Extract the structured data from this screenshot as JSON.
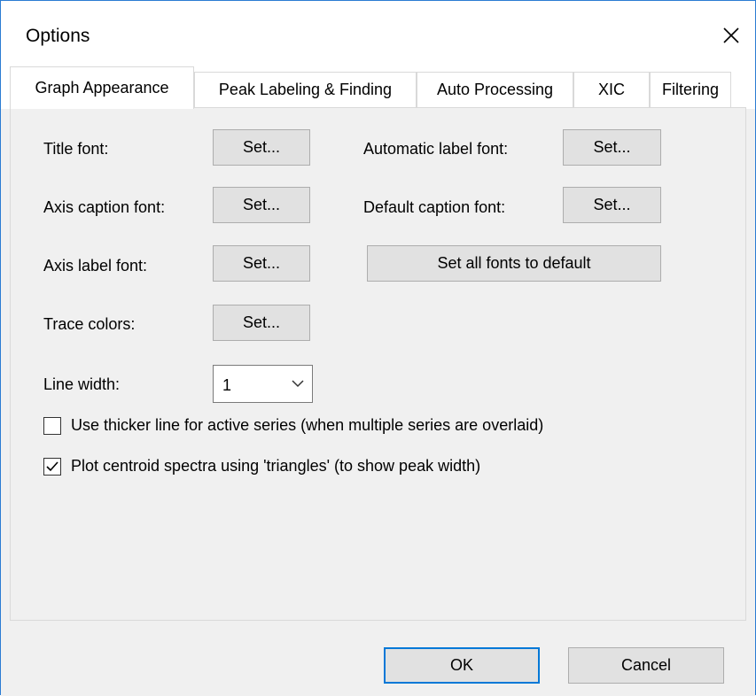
{
  "window": {
    "title": "Options",
    "close_icon": "close-icon"
  },
  "tabs": [
    {
      "label": "Graph Appearance",
      "active": true
    },
    {
      "label": "Peak Labeling & Finding",
      "active": false
    },
    {
      "label": "Auto Processing",
      "active": false
    },
    {
      "label": "XIC",
      "active": false
    },
    {
      "label": "Filtering",
      "active": false
    }
  ],
  "fonts": {
    "title_font_label": "Title font:",
    "axis_caption_font_label": "Axis caption font:",
    "axis_label_font_label": "Axis label font:",
    "trace_colors_label": "Trace colors:",
    "automatic_label_font_label": "Automatic label font:",
    "default_caption_font_label": "Default caption font:",
    "set_label": "Set...",
    "set_all_default_label": "Set all fonts to default"
  },
  "line_width": {
    "label": "Line width:",
    "value": "1"
  },
  "options": {
    "thicker_line": {
      "label": "Use thicker line for active series (when multiple series are overlaid)",
      "checked": false
    },
    "centroid_triangles": {
      "label": "Plot centroid spectra using 'triangles' (to show peak width)",
      "checked": true
    }
  },
  "footer": {
    "ok_label": "OK",
    "cancel_label": "Cancel"
  },
  "colors": {
    "accent": "#0078d7",
    "button_face": "#e1e1e1",
    "dialog_bg": "#f0f0f0"
  }
}
